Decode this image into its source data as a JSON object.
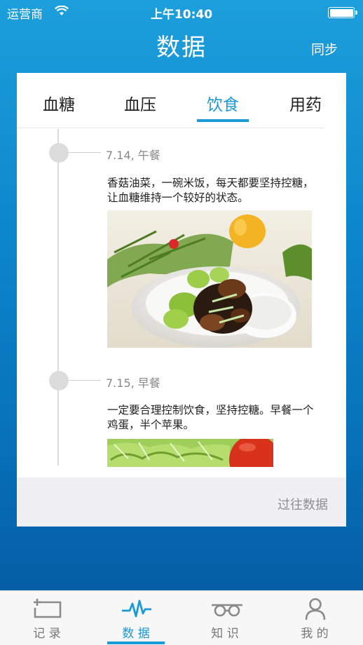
{
  "status_bar": {
    "carrier": "运营商",
    "time": "上午10:40",
    "battery_level": 1.0
  },
  "header": {
    "title": "数据",
    "sync_label": "同步"
  },
  "tabs": [
    {
      "label": "血糖",
      "active": false
    },
    {
      "label": "血压",
      "active": false
    },
    {
      "label": "饮食",
      "active": true
    },
    {
      "label": "用药",
      "active": false
    }
  ],
  "entries": [
    {
      "date": "7.14, 午餐",
      "text": "香菇油菜，一碗米饭，每天都要坚持控糖，让血糖维持一个较好的状态。",
      "photo": "rice-bowl-with-greens-photo"
    },
    {
      "date": "7.15, 早餐",
      "text": "一定要合理控制饮食，坚持控糖。早餐一个鸡蛋，半个苹果。",
      "photo": "lettuce-and-tomato-photo"
    }
  ],
  "footer": {
    "history_label": "过往数据"
  },
  "tab_bar": [
    {
      "label": "记 录",
      "icon": "record-icon",
      "active": false
    },
    {
      "label": "数 据",
      "icon": "pulse-icon",
      "active": true
    },
    {
      "label": "知 识",
      "icon": "knowledge-icon",
      "active": false
    },
    {
      "label": "我 的",
      "icon": "profile-icon",
      "active": false
    }
  ],
  "colors": {
    "accent": "#1a9ad8",
    "background_top": "#1d9fdc",
    "background_bottom": "#05569e"
  }
}
